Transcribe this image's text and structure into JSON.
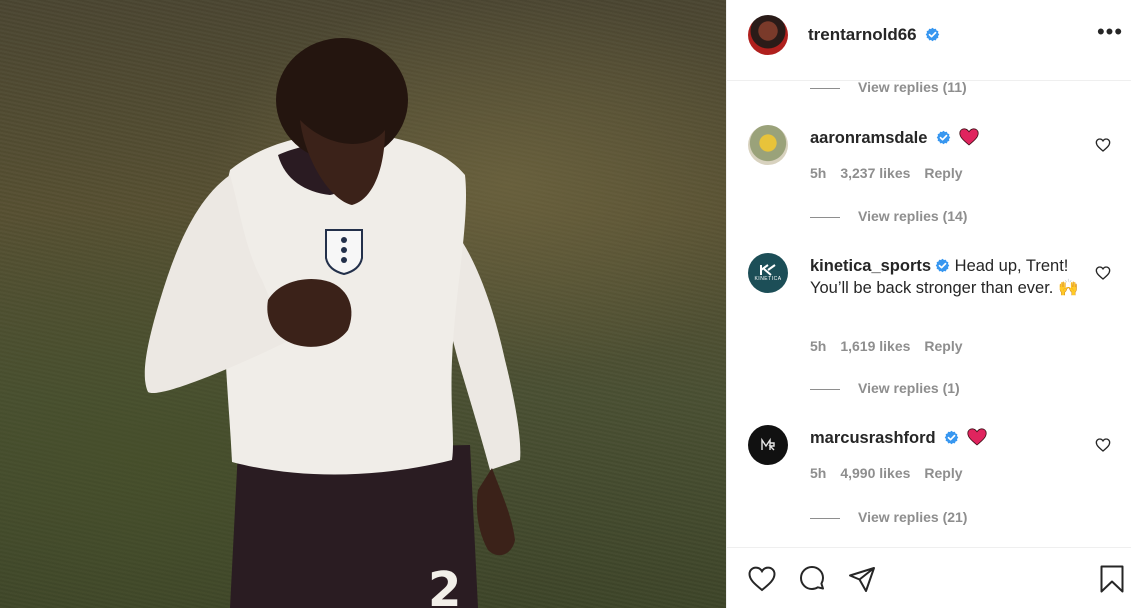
{
  "post": {
    "image_alt": "Player in white England shirt holding the crest, looking down",
    "shirt_number": "2"
  },
  "header": {
    "username": "trentarnold66",
    "more_label": "•••"
  },
  "replies_top": {
    "label": "View replies (11)"
  },
  "comments": [
    {
      "username": "aaronramsdale",
      "text": "",
      "time": "5h",
      "likes": "3,237 likes",
      "reply_label": "Reply",
      "view_replies": "View replies (14)"
    },
    {
      "username": "kinetica_sports",
      "text": "Head up, Trent! You’ll be back stronger than ever. 🙌",
      "time": "5h",
      "likes": "1,619 likes",
      "reply_label": "Reply",
      "view_replies": "View replies (1)",
      "avatar_text": "KINETICA"
    },
    {
      "username": "marcusrashford",
      "text": "",
      "time": "5h",
      "likes": "4,990 likes",
      "reply_label": "Reply",
      "view_replies": "View replies (21)"
    }
  ],
  "colors": {
    "verified": "#3897f0",
    "heart": "#e0245e",
    "muted_text": "#8e8e8e"
  },
  "icons": {
    "like": "heart-outline-icon",
    "comment": "speech-bubble-icon",
    "share": "paper-plane-icon",
    "save": "bookmark-icon"
  }
}
